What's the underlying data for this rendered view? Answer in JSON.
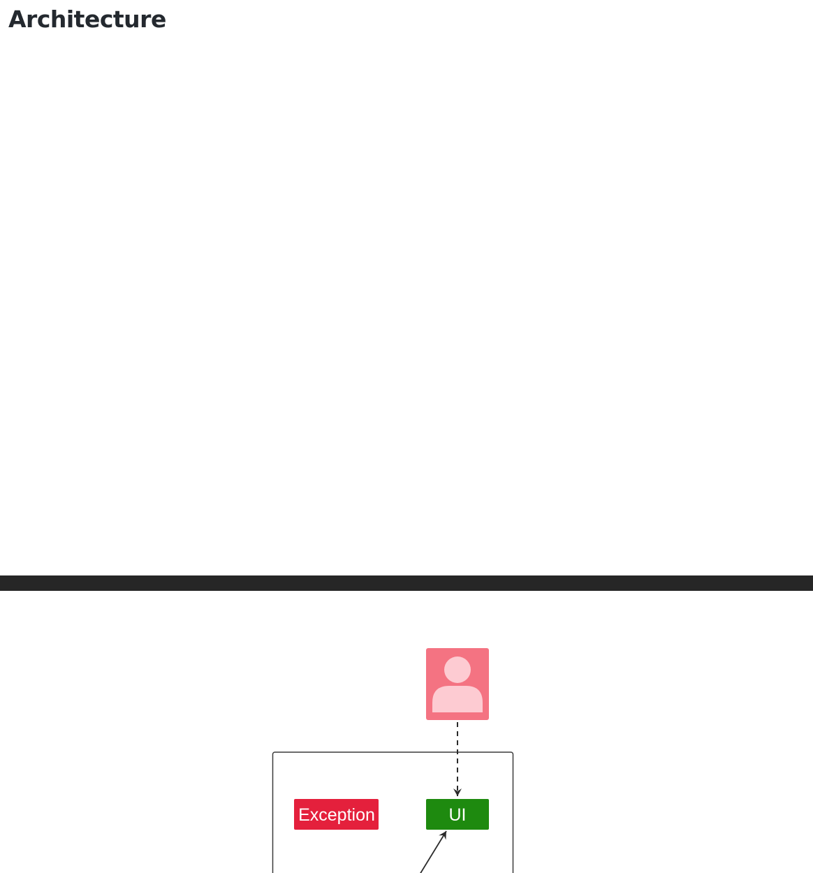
{
  "page": {
    "title": "Architecture"
  },
  "diagram": {
    "nodes": [
      {
        "id": "user",
        "kind": "actor",
        "icon": "user-icon",
        "color": "#f47382",
        "icon_color": "#fdcbd2"
      },
      {
        "id": "exception",
        "kind": "component",
        "label": "Exception",
        "color": "#e4203c"
      },
      {
        "id": "ui",
        "kind": "component",
        "label": "UI",
        "color": "#1e8a0f"
      }
    ],
    "edges": [
      {
        "from": "user",
        "to": "ui",
        "style": "dashed"
      },
      {
        "from": "off-screen",
        "to": "ui",
        "style": "solid"
      }
    ],
    "colors": {
      "divider": "#262626",
      "boundary": "#3a3a3a",
      "edge": "#2b2b2b"
    }
  }
}
